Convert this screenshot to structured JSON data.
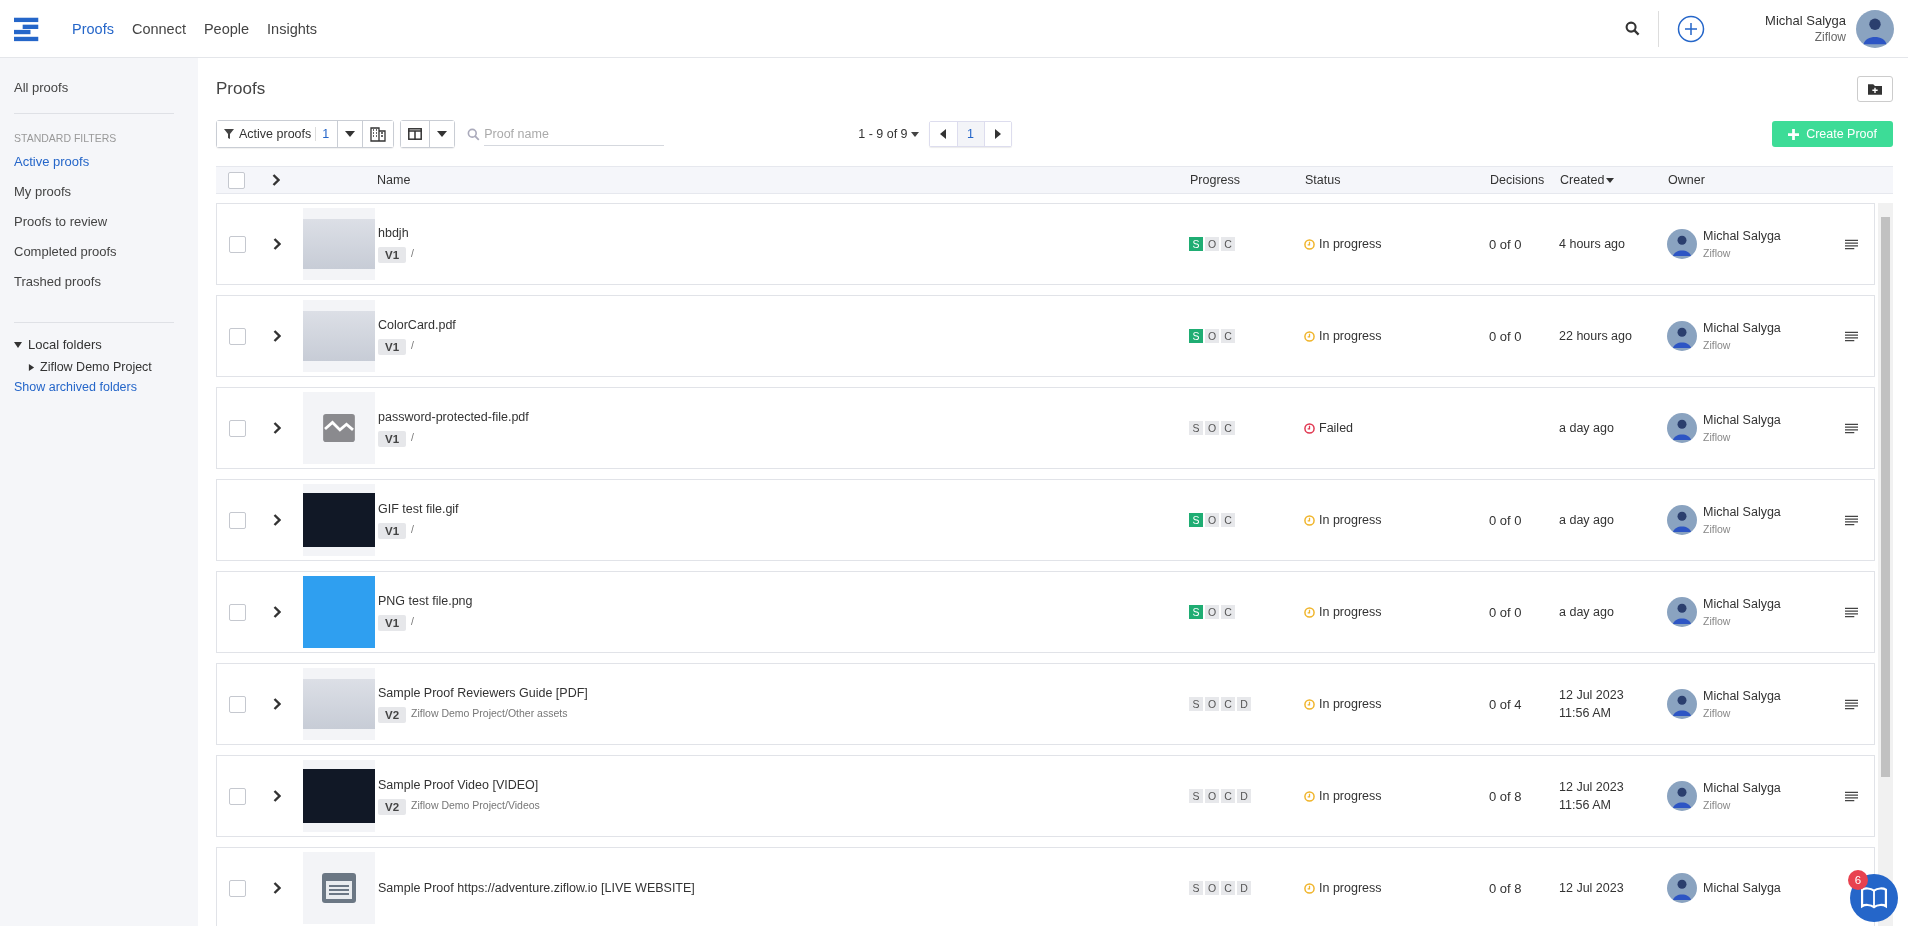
{
  "nav": {
    "items": [
      {
        "label": "Proofs",
        "selected": true
      },
      {
        "label": "Connect",
        "selected": false
      },
      {
        "label": "People",
        "selected": false
      },
      {
        "label": "Insights",
        "selected": false
      }
    ]
  },
  "user": {
    "name": "Michal Salyga",
    "org": "Ziflow"
  },
  "sidebar": {
    "all": "All proofs",
    "filters_heading": "STANDARD FILTERS",
    "filters": [
      {
        "label": "Active proofs",
        "selected": true
      },
      {
        "label": "My proofs",
        "selected": false
      },
      {
        "label": "Proofs to review",
        "selected": false
      },
      {
        "label": "Completed proofs",
        "selected": false
      },
      {
        "label": "Trashed proofs",
        "selected": false
      }
    ],
    "folders_heading": "Local folders",
    "folders_expanded": true,
    "folders": [
      {
        "label": "Ziflow Demo Project",
        "expanded": false
      }
    ],
    "archived_link": "Show archived folders"
  },
  "page_title": "Proofs",
  "toolbar": {
    "filter_label": "Active proofs",
    "filter_count": "1",
    "search_placeholder": "Proof name",
    "range": "1 - 9 of 9",
    "page": "1",
    "create_button": "Create Proof"
  },
  "table": {
    "select_all_checked": false,
    "columns": [
      "Name",
      "Progress",
      "Status",
      "Decisions",
      "Created",
      "Owner"
    ],
    "rows": [
      {
        "kind": "image",
        "checked": false,
        "menu": true,
        "name": "hbdjh",
        "version": "V1",
        "path": "/",
        "progress": [
          {
            "letter": "S",
            "on": true
          },
          {
            "letter": "O",
            "on": false
          },
          {
            "letter": "C",
            "on": false
          }
        ],
        "status": {
          "kind": "in_progress",
          "label": "In progress"
        },
        "decisions": "0 of 0",
        "created": [
          "4 hours ago"
        ],
        "owner": {
          "name": "Michal Salyga",
          "org": "Ziflow"
        }
      },
      {
        "kind": "image",
        "checked": false,
        "menu": true,
        "name": "ColorCard.pdf",
        "version": "V1",
        "path": "/",
        "progress": [
          {
            "letter": "S",
            "on": true
          },
          {
            "letter": "O",
            "on": false
          },
          {
            "letter": "C",
            "on": false
          }
        ],
        "status": {
          "kind": "in_progress",
          "label": "In progress"
        },
        "decisions": "0 of 0",
        "created": [
          "22 hours ago"
        ],
        "owner": {
          "name": "Michal Salyga",
          "org": "Ziflow"
        }
      },
      {
        "kind": "broken",
        "checked": false,
        "menu": true,
        "name": "password-protected-file.pdf",
        "version": "V1",
        "path": "/",
        "progress": [
          {
            "letter": "S",
            "on": false
          },
          {
            "letter": "O",
            "on": false
          },
          {
            "letter": "C",
            "on": false
          }
        ],
        "status": {
          "kind": "failed",
          "label": "Failed"
        },
        "created": [
          "a day ago"
        ],
        "owner": {
          "name": "Michal Salyga",
          "org": "Ziflow"
        }
      },
      {
        "kind": "dark",
        "checked": false,
        "menu": true,
        "name": "GIF test file.gif",
        "version": "V1",
        "path": "/",
        "progress": [
          {
            "letter": "S",
            "on": true
          },
          {
            "letter": "O",
            "on": false
          },
          {
            "letter": "C",
            "on": false
          }
        ],
        "status": {
          "kind": "in_progress",
          "label": "In progress"
        },
        "decisions": "0 of 0",
        "created": [
          "a day ago"
        ],
        "owner": {
          "name": "Michal Salyga",
          "org": "Ziflow"
        }
      },
      {
        "kind": "blue",
        "checked": false,
        "menu": true,
        "name": "PNG test file.png",
        "version": "V1",
        "path": "/",
        "progress": [
          {
            "letter": "S",
            "on": true
          },
          {
            "letter": "O",
            "on": false
          },
          {
            "letter": "C",
            "on": false
          }
        ],
        "status": {
          "kind": "in_progress",
          "label": "In progress"
        },
        "decisions": "0 of 0",
        "created": [
          "a day ago"
        ],
        "owner": {
          "name": "Michal Salyga",
          "org": "Ziflow"
        }
      },
      {
        "kind": "image",
        "checked": false,
        "menu": true,
        "name": "Sample Proof Reviewers Guide [PDF]",
        "version": "V2",
        "path": "Ziflow Demo Project/Other assets",
        "progress": [
          {
            "letter": "S",
            "on": false
          },
          {
            "letter": "O",
            "on": false
          },
          {
            "letter": "C",
            "on": false
          },
          {
            "letter": "D",
            "on": false
          }
        ],
        "status": {
          "kind": "in_progress",
          "label": "In progress"
        },
        "decisions": "0 of 4",
        "created": [
          "12 Jul 2023",
          "11:56 AM"
        ],
        "owner": {
          "name": "Michal Salyga",
          "org": "Ziflow"
        }
      },
      {
        "kind": "dark",
        "checked": false,
        "menu": true,
        "name": "Sample Proof Video [VIDEO]",
        "version": "V2",
        "path": "Ziflow Demo Project/Videos",
        "progress": [
          {
            "letter": "S",
            "on": false
          },
          {
            "letter": "O",
            "on": false
          },
          {
            "letter": "C",
            "on": false
          },
          {
            "letter": "D",
            "on": false
          }
        ],
        "status": {
          "kind": "in_progress",
          "label": "In progress"
        },
        "decisions": "0 of 8",
        "created": [
          "12 Jul 2023",
          "11:56 AM"
        ],
        "owner": {
          "name": "Michal Salyga",
          "org": "Ziflow"
        }
      },
      {
        "kind": "page",
        "checked": false,
        "menu": false,
        "name": "Sample Proof https://adventure.ziflow.io [LIVE WEBSITE]",
        "progress": [
          {
            "letter": "S",
            "on": false
          },
          {
            "letter": "O",
            "on": false
          },
          {
            "letter": "C",
            "on": false
          },
          {
            "letter": "D",
            "on": false
          }
        ],
        "status": {
          "kind": "in_progress",
          "label": "In progress"
        },
        "decisions": "0 of 8",
        "created": [
          "12 Jul 2023"
        ],
        "owner": {
          "name": "Michal Salyga"
        }
      }
    ]
  },
  "help": {
    "badge": "6"
  }
}
